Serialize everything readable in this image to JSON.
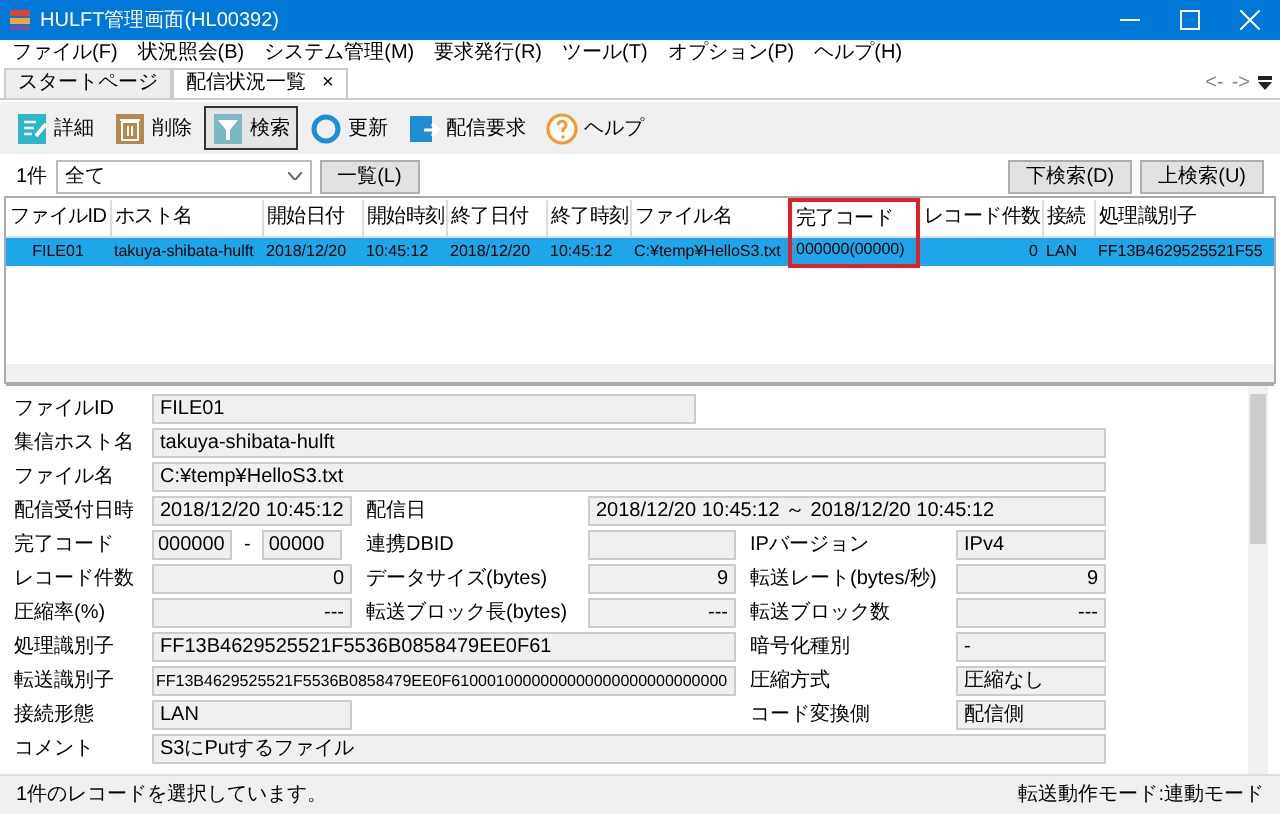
{
  "window": {
    "title": "HULFT管理画面(HL00392)"
  },
  "menu": [
    "ファイル(F)",
    "状況照会(B)",
    "システム管理(M)",
    "要求発行(R)",
    "ツール(T)",
    "オプション(P)",
    "ヘルプ(H)"
  ],
  "tabs": [
    {
      "label": "スタートページ",
      "selected": false,
      "closable": false
    },
    {
      "label": "配信状況一覧",
      "selected": true,
      "closable": true,
      "close": "×"
    }
  ],
  "tab_nav": {
    "back": "<-",
    "forward": "->"
  },
  "toolbar": [
    {
      "kind": "detail",
      "label": "詳細",
      "selected": false
    },
    {
      "kind": "delete",
      "label": "削除",
      "selected": false
    },
    {
      "kind": "filter",
      "label": "検索",
      "selected": true
    },
    {
      "kind": "refresh",
      "label": "更新",
      "selected": false
    },
    {
      "kind": "send",
      "label": "配信要求",
      "selected": false
    },
    {
      "kind": "help",
      "label": "ヘルプ",
      "selected": false
    }
  ],
  "filter": {
    "count": "1件",
    "select_value": "全て",
    "list_button": "一覧(L)",
    "search_down": "下検索(D)",
    "search_up": "上検索(U)"
  },
  "table": {
    "columns": [
      {
        "label": "ファイルID",
        "highlighted": false
      },
      {
        "label": "ホスト名",
        "highlighted": false
      },
      {
        "label": "開始日付",
        "highlighted": false
      },
      {
        "label": "開始時刻",
        "highlighted": false
      },
      {
        "label": "終了日付",
        "highlighted": false
      },
      {
        "label": "終了時刻",
        "highlighted": false
      },
      {
        "label": "ファイル名",
        "highlighted": false
      },
      {
        "label": "完了コード",
        "highlighted": true
      },
      {
        "label": "レコード件数",
        "highlighted": false
      },
      {
        "label": "接続",
        "highlighted": false
      },
      {
        "label": "処理識別子",
        "highlighted": false
      }
    ],
    "rows": [
      {
        "selected": true,
        "cells": [
          "FILE01",
          "takuya-shibata-hulft",
          "2018/12/20",
          "10:45:12",
          "2018/12/20",
          "10:45:12",
          "C:¥temp¥HelloS3.txt",
          "000000(00000)",
          "0",
          "LAN",
          "FF13B4629525521F55"
        ]
      }
    ]
  },
  "details": [
    {
      "label": "ファイルID",
      "value": "FILE01"
    },
    {
      "label": "集信ホスト名",
      "value": "takuya-shibata-hulft"
    },
    {
      "label": "ファイル名",
      "value": "C:¥temp¥HelloS3.txt"
    },
    {
      "label": "配信受付日時",
      "value": "2018/12/20 10:45:12"
    },
    {
      "label": "配信日",
      "value": "2018/12/20 10:45:12 ～ 2018/12/20 10:45:12"
    },
    {
      "label": "完了コード",
      "values": [
        "000000",
        "00000"
      ],
      "separator": "-"
    },
    {
      "label": "連携DBID"
    },
    {
      "label": "IPバージョン",
      "value": "IPv4"
    },
    {
      "label": "レコード件数",
      "value": "0"
    },
    {
      "label": "データサイズ(bytes)",
      "value": "9"
    },
    {
      "label": "転送レート(bytes/秒)",
      "value": "9"
    },
    {
      "label": "圧縮率(%)",
      "value": "---"
    },
    {
      "label": "転送ブロック長(bytes)",
      "value": "---"
    },
    {
      "label": "転送ブロック数",
      "value": "---"
    },
    {
      "label": "処理識別子",
      "value": "FF13B4629525521F5536B0858479EE0F61"
    },
    {
      "label": "暗号化種別",
      "value": "-"
    },
    {
      "label": "転送識別子",
      "value": "FF13B4629525521F5536B0858479EE0F6100010000000000000000000000000"
    },
    {
      "label": "圧縮方式",
      "value": "圧縮なし"
    },
    {
      "label": "接続形態",
      "value": "LAN"
    },
    {
      "label": "コード変換側",
      "value": "配信側"
    },
    {
      "label": "コメント",
      "value": "S3にPutするファイル"
    }
  ],
  "status_bar": {
    "left": "1件のレコードを選択しています。",
    "right": "転送動作モード:連動モード"
  }
}
